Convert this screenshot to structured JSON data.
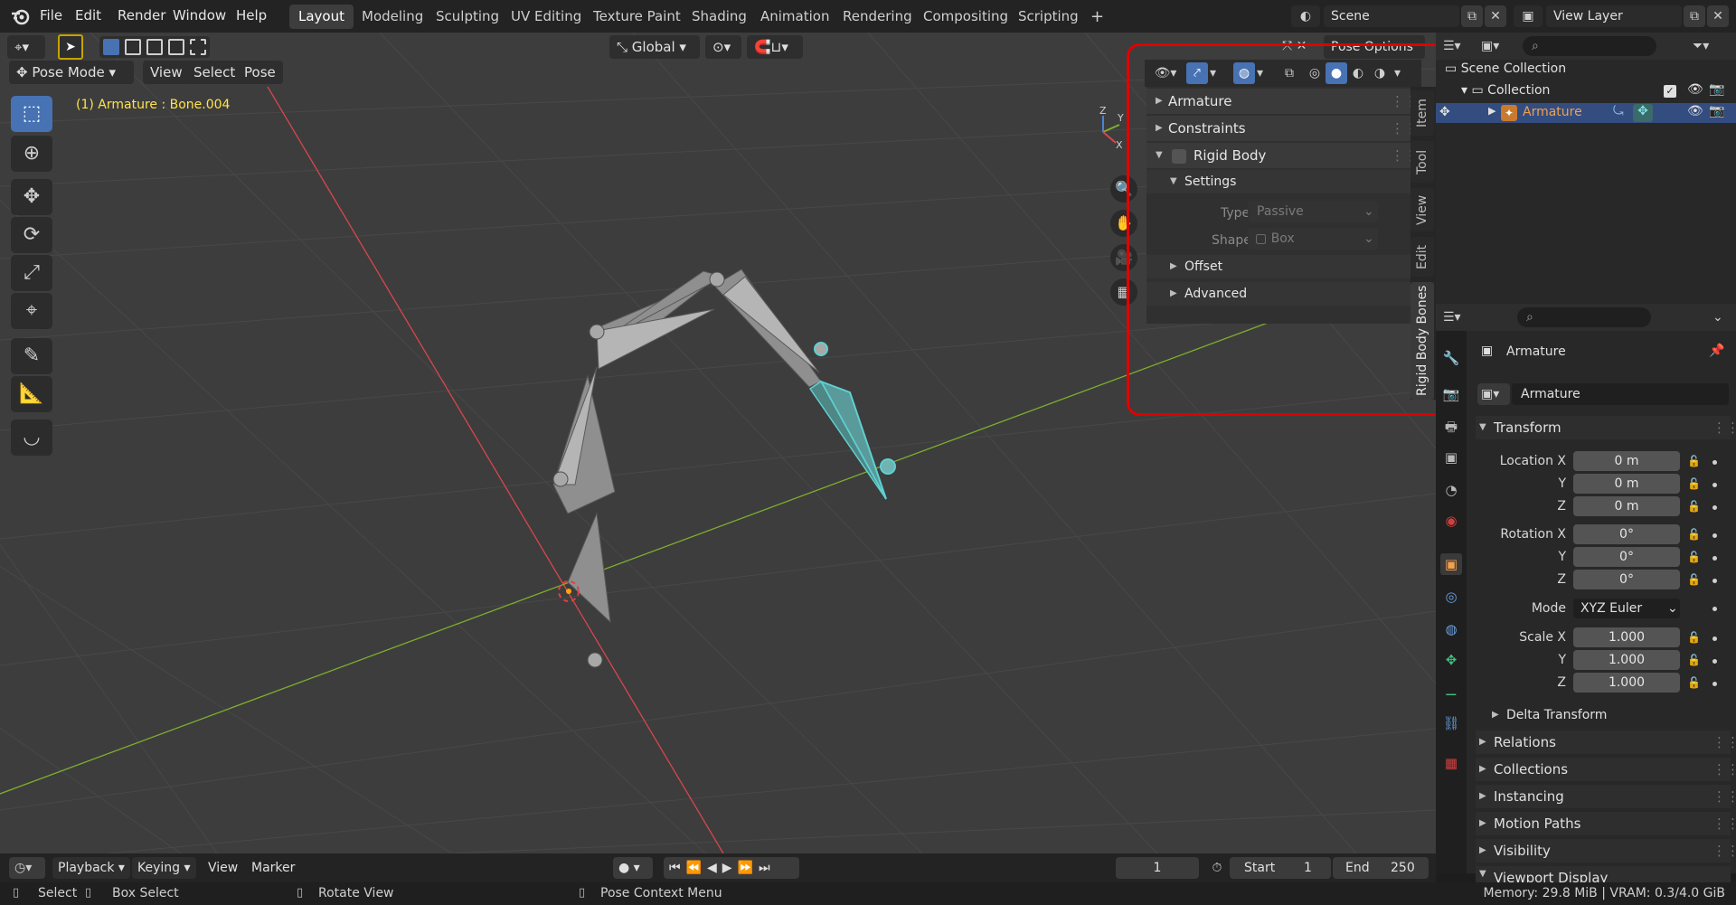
{
  "top_menu": [
    "File",
    "Edit",
    "Render",
    "Window",
    "Help"
  ],
  "workspaces": [
    {
      "label": "Layout",
      "active": true
    },
    {
      "label": "Modeling",
      "active": false
    },
    {
      "label": "Sculpting",
      "active": false
    },
    {
      "label": "UV Editing",
      "active": false
    },
    {
      "label": "Texture Paint",
      "active": false
    },
    {
      "label": "Shading",
      "active": false
    },
    {
      "label": "Animation",
      "active": false
    },
    {
      "label": "Rendering",
      "active": false
    },
    {
      "label": "Compositing",
      "active": false
    },
    {
      "label": "Scripting",
      "active": false
    }
  ],
  "add_workspace": "+",
  "scene": {
    "name": "Scene"
  },
  "view_layer": {
    "name": "View Layer"
  },
  "viewport": {
    "mode": "Pose Mode",
    "menus": [
      "View",
      "Select",
      "Pose"
    ],
    "transform_orientation": "Global",
    "pose_options": "Pose Options",
    "overlay_text": "(1) Armature : Bone.004",
    "gizmo_axes": {
      "x": "X",
      "y": "Y",
      "z": "Z"
    }
  },
  "npanel": {
    "sections": {
      "armature": "Armature",
      "constraints": "Constraints",
      "rigid_body": "Rigid Body",
      "settings": "Settings",
      "offset": "Offset",
      "advanced": "Advanced"
    },
    "type_label": "Type",
    "type_value": "Passive",
    "shape_label": "Shape",
    "shape_value": "Box",
    "tabs": [
      "Item",
      "Tool",
      "View",
      "Edit",
      "Rigid Body Bones"
    ]
  },
  "outliner": {
    "root": "Scene Collection",
    "collection": "Collection",
    "object": "Armature"
  },
  "properties": {
    "object_name": "Armature",
    "datablock": "Armature",
    "transform_title": "Transform",
    "location_label": "Location X",
    "rotation_label": "Rotation X",
    "scale_label": "Scale X",
    "axis_y": "Y",
    "axis_z": "Z",
    "location": [
      "0 m",
      "0 m",
      "0 m"
    ],
    "rotation": [
      "0°",
      "0°",
      "0°"
    ],
    "mode_label": "Mode",
    "mode_value": "XYZ Euler",
    "scale": [
      "1.000",
      "1.000",
      "1.000"
    ],
    "delta_transform": "Delta Transform",
    "sections": [
      "Relations",
      "Collections",
      "Instancing",
      "Motion Paths",
      "Visibility",
      "Viewport Display"
    ]
  },
  "timeline": {
    "menus": [
      "Playback",
      "Keying",
      "View",
      "Marker"
    ],
    "current_frame": "1",
    "start_label": "Start",
    "start": "1",
    "end_label": "End",
    "end": "250"
  },
  "status": {
    "select": "Select",
    "box_select": "Box Select",
    "rotate_view": "Rotate View",
    "context_menu": "Pose Context Menu",
    "memory": "Memory: 29.8 MiB | VRAM: 0.3/4.0 GiB"
  },
  "colors": {
    "accent": "#4772b3",
    "selected_bone": "#5fd0d0",
    "highlight_box": "#e00000",
    "x_axis": "#d8464e",
    "y_axis": "#7fae2e",
    "overlay_text": "#ffe24a"
  }
}
